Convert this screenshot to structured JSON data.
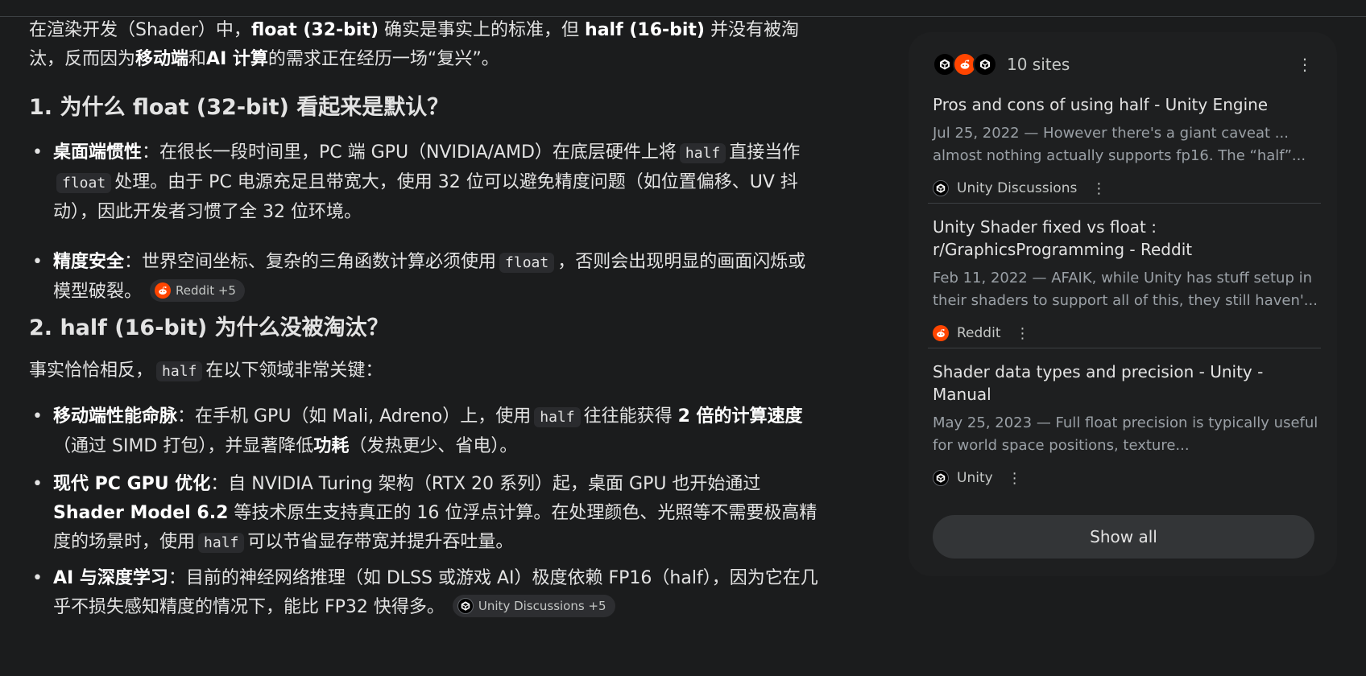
{
  "answer": {
    "intro": [
      {
        "t": "在渲染开发（Shader）中，"
      },
      {
        "t": "float (32-bit)",
        "b": true
      },
      {
        "t": " 确实是事实上的标准，但 "
      },
      {
        "t": "half (16-bit)",
        "b": true
      },
      {
        "t": " 并没有被淘汰，反而因为"
      },
      {
        "t": "移动端",
        "b": true
      },
      {
        "t": "和"
      },
      {
        "t": "AI 计算",
        "b": true
      },
      {
        "t": "的需求正在经历一场“复兴”。"
      }
    ],
    "section1_heading": "1. 为什么 float (32-bit) 看起来是默认？",
    "section1_bullets": [
      [
        {
          "t": "桌面端惯性",
          "b": true
        },
        {
          "t": "：在很长一段时间里，PC 端 GPU（NVIDIA/AMD）在底层硬件上将"
        },
        {
          "t": "half",
          "c": true
        },
        {
          "t": "直接当作"
        },
        {
          "t": "float",
          "c": true
        },
        {
          "t": "处理。由于 PC 电源充足且带宽大，使用 32 位可以避免精度问题（如位置偏移、UV 抖动），因此开发者习惯了全 32 位环境。"
        }
      ],
      [
        {
          "t": "精度安全",
          "b": true
        },
        {
          "t": "：世界空间坐标、复杂的三角函数计算必须使用"
        },
        {
          "t": "float",
          "c": true
        },
        {
          "t": "，否则会出现明显的画面闪烁或模型破裂。"
        },
        {
          "chip": "Reddit +5",
          "icon": "reddit"
        }
      ]
    ],
    "section2_heading": "2. half (16-bit) 为什么没被淘汰？",
    "section2_lead": [
      {
        "t": "事实恰恰相反，"
      },
      {
        "t": "half",
        "c": true
      },
      {
        "t": "在以下领域非常关键："
      }
    ],
    "section2_bullets": [
      [
        {
          "t": "移动端性能命脉",
          "b": true
        },
        {
          "t": "：在手机 GPU（如 Mali, Adreno）上，使用"
        },
        {
          "t": "half",
          "c": true
        },
        {
          "t": "往往能获得 "
        },
        {
          "t": "2 倍的计算速度",
          "b": true
        },
        {
          "t": "（通过 SIMD 打包），并显著降低"
        },
        {
          "t": "功耗",
          "b": true
        },
        {
          "t": "（发热更少、省电）。"
        }
      ],
      [
        {
          "t": "现代 PC GPU 优化",
          "b": true
        },
        {
          "t": "：自 NVIDIA Turing 架构（RTX 20 系列）起，桌面 GPU 也开始通过 "
        },
        {
          "t": "Shader Model 6.2",
          "b": true
        },
        {
          "t": " 等技术原生支持真正的 16 位浮点计算。在处理颜色、光照等不需要极高精度的场景时，使用"
        },
        {
          "t": "half",
          "c": true
        },
        {
          "t": "可以节省显存带宽并提升吞吐量。"
        }
      ],
      [
        {
          "t": "AI 与深度学习",
          "b": true
        },
        {
          "t": "：目前的神经网络推理（如 DLSS 或游戏 AI）极度依赖 FP16（half），因为它在几乎不损失感知精度的情况下，能比 FP32 快得多。"
        },
        {
          "chip": "Unity Discussions +5",
          "icon": "unity"
        }
      ]
    ]
  },
  "sources": {
    "count_label": "10 sites",
    "more_icon": "more-vert-icon",
    "items": [
      {
        "title": "Pros and cons of using half - Unity Engine",
        "snippet": "Jul 25, 2022 — However there's a giant caveat ... almost nothing actually supports fp16. The “half”...",
        "site": "Unity Discussions",
        "icon": "unity"
      },
      {
        "title": "Unity Shader fixed vs float : r/GraphicsProgramming - Reddit",
        "snippet": "Feb 11, 2022 — AFAIK, while Unity has stuff setup in their shaders to support all of this, they still haven'...",
        "site": "Reddit",
        "icon": "reddit"
      },
      {
        "title": "Shader data types and precision - Unity - Manual",
        "snippet": "May 25, 2023 — Full float precision is typically useful for world space positions, texture...",
        "site": "Unity",
        "icon": "unity"
      }
    ],
    "show_all_label": "Show all"
  },
  "colors": {
    "background": "#1b1c1d",
    "card": "#1e1f20",
    "reddit": "#ff4500",
    "text": "#e3e3e3",
    "muted": "#9aa0a6"
  }
}
